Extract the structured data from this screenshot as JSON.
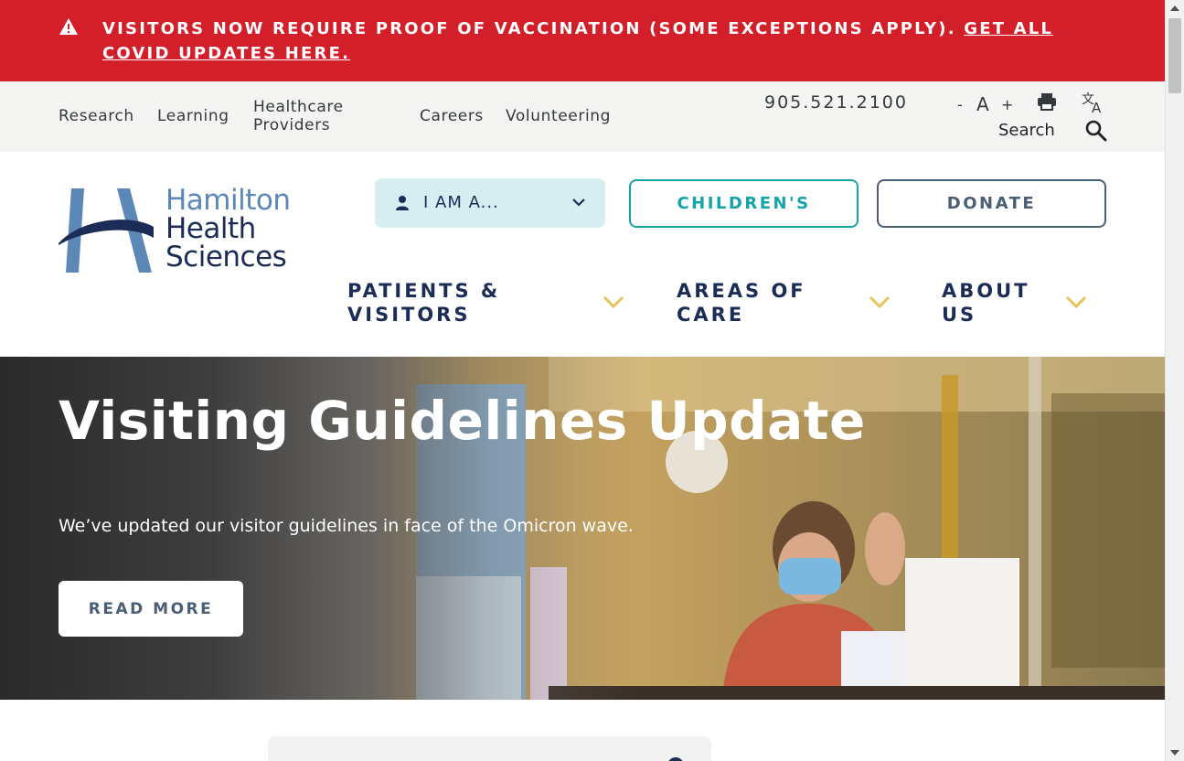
{
  "alert": {
    "message": "VISITORS NOW REQUIRE PROOF OF VACCINATION (SOME EXCEPTIONS APPLY).",
    "link_text": "GET ALL COVID UPDATES HERE.",
    "icon": "warning-icon",
    "color": "#d21f2a"
  },
  "utility": {
    "links": [
      "Research",
      "Learning",
      "Healthcare Providers",
      "Careers",
      "Volunteering"
    ],
    "phone": "905.521.2100",
    "font_decrease": "-",
    "font_label": "A",
    "font_increase": "+",
    "print_icon": "printer-icon",
    "translate_icon": "translate-icon",
    "search_label": "Search",
    "search_icon": "search-icon"
  },
  "header": {
    "logo": {
      "line1": "Hamilton",
      "line2": "Health",
      "line3": "Sciences"
    },
    "iam": {
      "label": "I AM A...",
      "icon": "person-icon"
    },
    "children_label": "CHILDREN'S",
    "donate_label": "DONATE",
    "nav": {
      "patients": "PATIENTS & VISITORS",
      "areas": "AREAS OF CARE",
      "about": "ABOUT US"
    },
    "colors": {
      "navy": "#1b2c57",
      "teal": "#14a3a6",
      "slate": "#4a5f76",
      "gold": "#e8c25a"
    }
  },
  "hero": {
    "title": "Visiting Guidelines Update",
    "subtitle": "We’ve updated our visitor guidelines in face of the Omicron wave.",
    "button_label": "READ MORE"
  }
}
